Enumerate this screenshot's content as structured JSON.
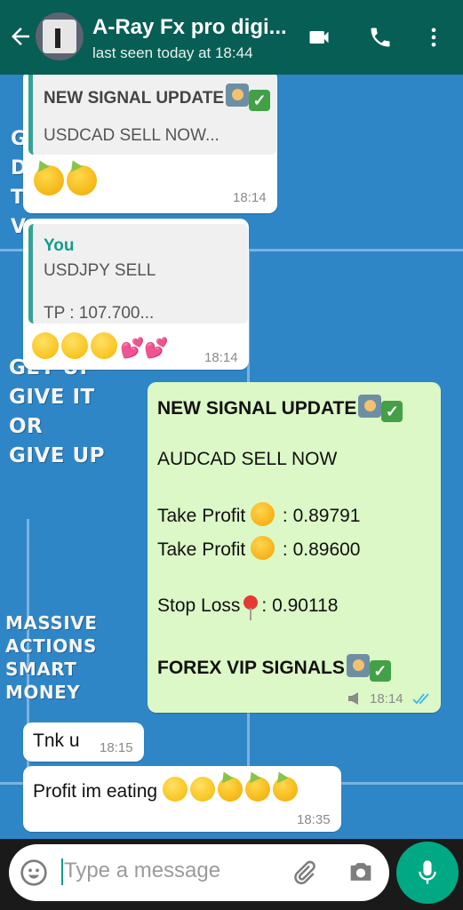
{
  "header": {
    "contact_name": "A-Ray Fx pro digi...",
    "last_seen": "last seen today at 18:44"
  },
  "wallpaper": {
    "lines1": [
      "G",
      "D",
      "T",
      "V"
    ],
    "lines2": [
      "GET UP",
      "GIVE IT",
      "OR",
      "GIVE UP"
    ],
    "lines3": [
      "MASSIVE",
      "ACTIONS",
      "SMART",
      "MONEY"
    ]
  },
  "messages": {
    "m1": {
      "quote_line1": "NEW SIGNAL UPDATE",
      "quote_line2": "USDCAD SELL NOW...",
      "time": "18:14"
    },
    "m2": {
      "quote_name": "You",
      "quote_line1": "USDJPY SELL",
      "quote_line2": "TP : 107.700...",
      "time": "18:14"
    },
    "m3": {
      "line1": "NEW SIGNAL UPDATE",
      "line2": "AUDCAD SELL NOW",
      "tp1_label": "Take Profit",
      "tp1_value": ": 0.89791",
      "tp2_label": "Take Profit",
      "tp2_value": ": 0.89600",
      "sl_label": "Stop Loss",
      "sl_value": ": 0.90118",
      "footer": "FOREX VIP SIGNALS",
      "time": "18:14"
    },
    "m4": {
      "text": "Tnk u",
      "time": "18:15"
    },
    "m5": {
      "text": "Profit im eating",
      "time": "18:35"
    }
  },
  "composer": {
    "placeholder": "Type a message"
  },
  "colors": {
    "header": "#075e54",
    "outgoing": "#dcf8c6",
    "incoming": "#ffffff",
    "accent": "#00a884",
    "wallpaper": "#2f86c6"
  },
  "icons": [
    "back-arrow-icon",
    "video-call-icon",
    "phone-icon",
    "more-options-icon",
    "emoji-icon",
    "attach-icon",
    "camera-icon",
    "mic-icon",
    "double-check-icon"
  ]
}
